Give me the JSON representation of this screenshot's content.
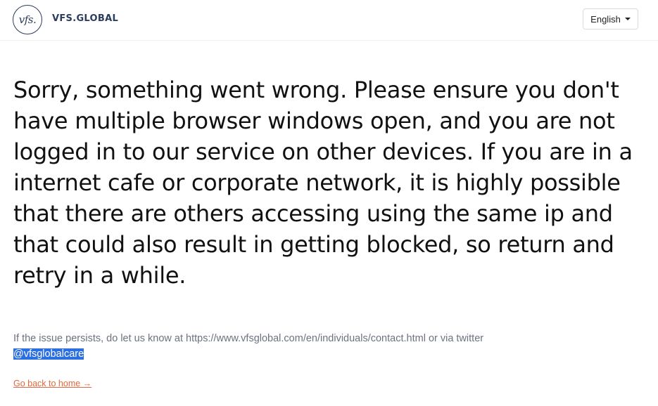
{
  "header": {
    "logo_mark": "vfs.",
    "logo_text": "VFS.GLOBAL",
    "language": {
      "selected": "English",
      "icon": "caret-down-icon"
    }
  },
  "main": {
    "message": "Sorry, something went wrong. Please ensure you don't have multiple browser windows open, and you are not logged in to our service on other devices. If you are in a internet cafe or corporate network, it is highly possible that there are others accessing using the same ip and that could also result in getting blocked, so return and retry in a while.",
    "support_text": "If the issue persists, do let us know at https://www.vfsglobal.com/en/individuals/contact.html or via twitter",
    "twitter_handle": "@vfsglobalcare",
    "back_link": "Go back to home →"
  },
  "colors": {
    "brand": "#2b3c5e",
    "link": "#e2683c",
    "selection": "#2b6fe0"
  }
}
